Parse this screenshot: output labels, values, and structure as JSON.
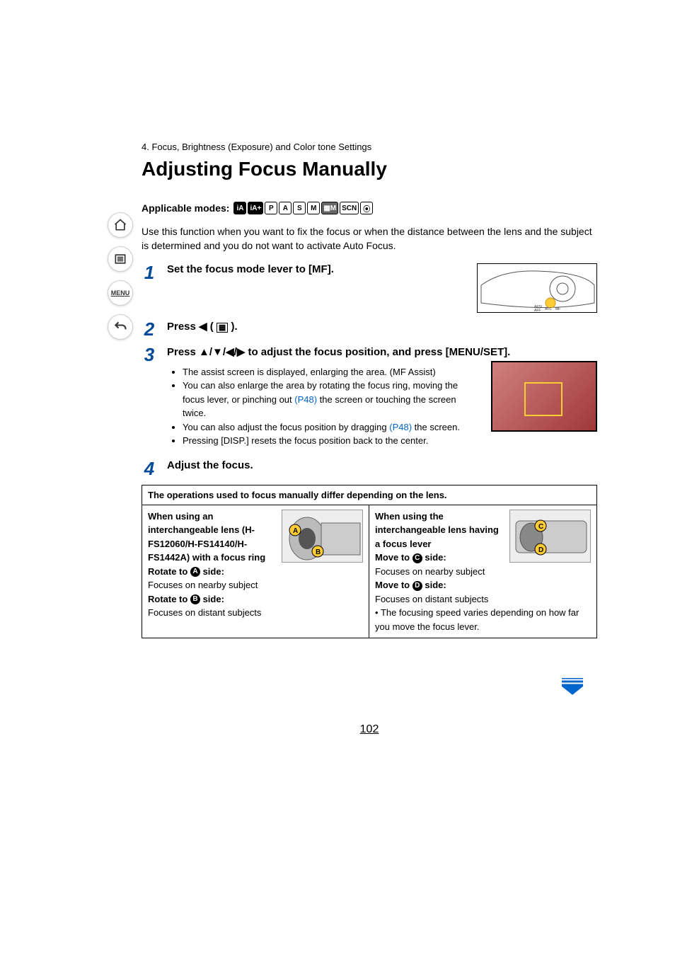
{
  "breadcrumb": "4. Focus, Brightness (Exposure) and Color tone Settings",
  "title": "Adjusting Focus Manually",
  "applicable_label": "Applicable modes:",
  "mode_icons": [
    "iA",
    "iA+",
    "P",
    "A",
    "S",
    "M",
    "▦M",
    "SCN",
    "⦿"
  ],
  "intro": "Use this function when you want to fix the focus or when the distance between the lens and the subject is determined and you do not want to activate Auto Focus.",
  "steps": {
    "s1": {
      "num": "1",
      "title": "Set the focus mode lever to [MF]."
    },
    "s2": {
      "num": "2",
      "title_pre": "Press ◀ ( ",
      "title_post": " )."
    },
    "s3": {
      "num": "3",
      "title": "Press ▲/▼/◀/▶ to adjust the focus position, and press [MENU/SET].",
      "n1": "The assist screen is displayed, enlarging the area. (MF Assist)",
      "n2a": "You can also enlarge the area by rotating the focus ring, moving the focus lever, or pinching out ",
      "n2link": "(P48)",
      "n2b": " the screen or touching the screen twice.",
      "n3a": "You can also adjust the focus position by dragging ",
      "n3link": "(P48)",
      "n3b": " the screen.",
      "n4": "Pressing [DISP.] resets the focus position back to the center."
    },
    "s4": {
      "num": "4",
      "title": "Adjust the focus."
    }
  },
  "box": {
    "header": "The operations used to focus manually differ depending on the lens.",
    "left": {
      "h": "When using an interchangeable lens (H-FS12060/H-FS14140/H-FS1442A) with a focus ring",
      "ra": "Rotate to ",
      "a": "A",
      "side": " side:",
      "la": "Focuses on nearby subject",
      "rb": "Rotate to ",
      "b": "B",
      "lb": "Focuses on distant subjects"
    },
    "right": {
      "h": "When using the interchangeable lens having a focus lever",
      "mc": "Move to ",
      "c": "C",
      "side": " side:",
      "lc": "Focuses on nearby subject",
      "md": "Move to ",
      "d": "D",
      "ld": "Focuses on distant subjects",
      "note": "The focusing speed varies depending on how far you move the focus lever."
    }
  },
  "nav": {
    "menu": "MENU"
  },
  "page_number": "102"
}
